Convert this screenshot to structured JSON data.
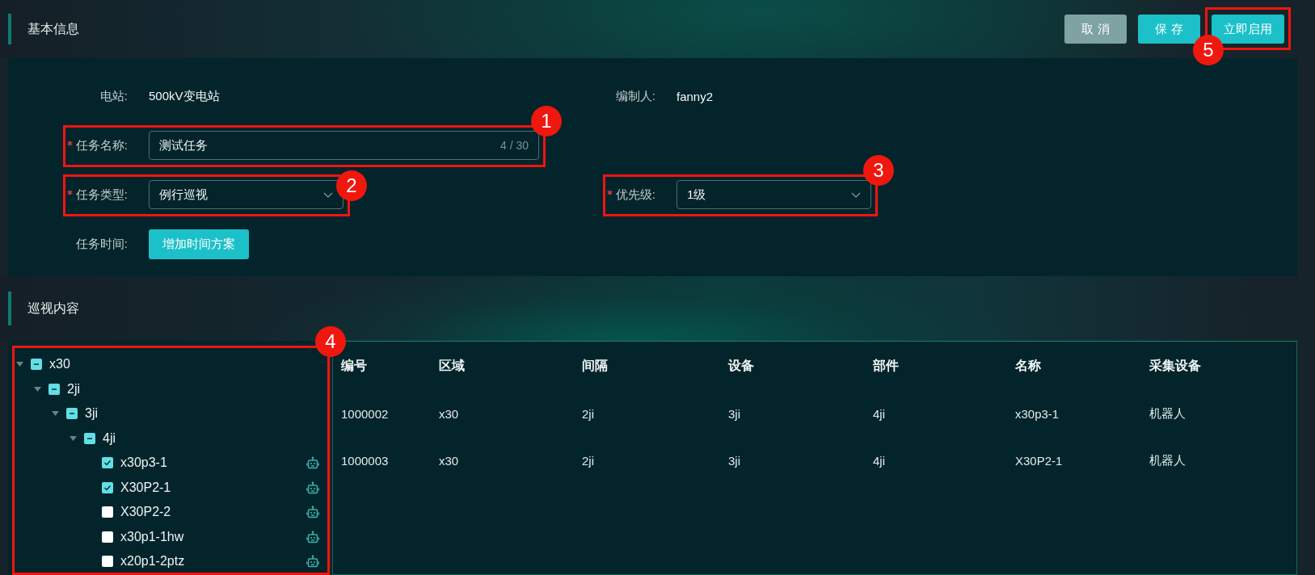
{
  "basic_info": {
    "title": "基本信息",
    "buttons": [
      {
        "label": "取 消",
        "kind": "secondary"
      },
      {
        "label": "保 存",
        "kind": "primary"
      },
      {
        "label": "立即启用",
        "kind": "primary",
        "callout": "5"
      }
    ]
  },
  "form": {
    "rows": [
      [
        {
          "label": "电站:",
          "kind": "text",
          "value": "500kV变电站",
          "required": false
        },
        {
          "label": "编制人:",
          "kind": "text",
          "value": "fanny2",
          "required": false
        }
      ],
      [
        {
          "label": "任务名称:",
          "kind": "input",
          "value": "测试任务",
          "counter": "4 / 30",
          "required": true,
          "callout": "1"
        }
      ],
      [
        {
          "label": "任务类型:",
          "kind": "select",
          "value": "例行巡视",
          "required": true,
          "callout": "2"
        },
        {
          "label": "优先级:",
          "kind": "select",
          "value": "1级",
          "required": true,
          "callout": "3"
        }
      ],
      [
        {
          "label": "任务时间:",
          "kind": "button",
          "value": "增加时间方案",
          "required": false
        }
      ]
    ]
  },
  "inspection": {
    "title": "巡视内容",
    "tree": {
      "callout": "4",
      "nodes": [
        {
          "label": "x30",
          "kind": "group",
          "expanded": true,
          "checked": true,
          "indeterminate": true,
          "children": [
            {
              "label": "2ji",
              "kind": "group",
              "expanded": true,
              "checked": true,
              "indeterminate": true,
              "children": [
                {
                  "label": "3ji",
                  "kind": "group",
                  "expanded": true,
                  "checked": true,
                  "indeterminate": true,
                  "children": [
                    {
                      "label": "4ji",
                      "kind": "group",
                      "expanded": true,
                      "checked": true,
                      "indeterminate": true,
                      "children": [
                        {
                          "label": "x30p3-1",
                          "kind": "point",
                          "checked": true
                        },
                        {
                          "label": "X30P2-1",
                          "kind": "point",
                          "checked": true
                        },
                        {
                          "label": "X30P2-2",
                          "kind": "point",
                          "checked": false
                        },
                        {
                          "label": "x30p1-1hw",
                          "kind": "point",
                          "checked": false
                        },
                        {
                          "label": "x20p1-2ptz",
                          "kind": "point",
                          "checked": false
                        }
                      ]
                    }
                  ]
                }
              ]
            }
          ]
        }
      ]
    },
    "table": {
      "columns": [
        "编号",
        "区域",
        "间隔",
        "设备",
        "部件",
        "名称",
        "采集设备"
      ],
      "rows": [
        [
          "1000002",
          "x30",
          "2ji",
          "3ji",
          "4ji",
          "x30p3-1",
          "机器人"
        ],
        [
          "1000003",
          "x30",
          "2ji",
          "3ji",
          "4ji",
          "X30P2-1",
          "机器人"
        ]
      ]
    }
  }
}
